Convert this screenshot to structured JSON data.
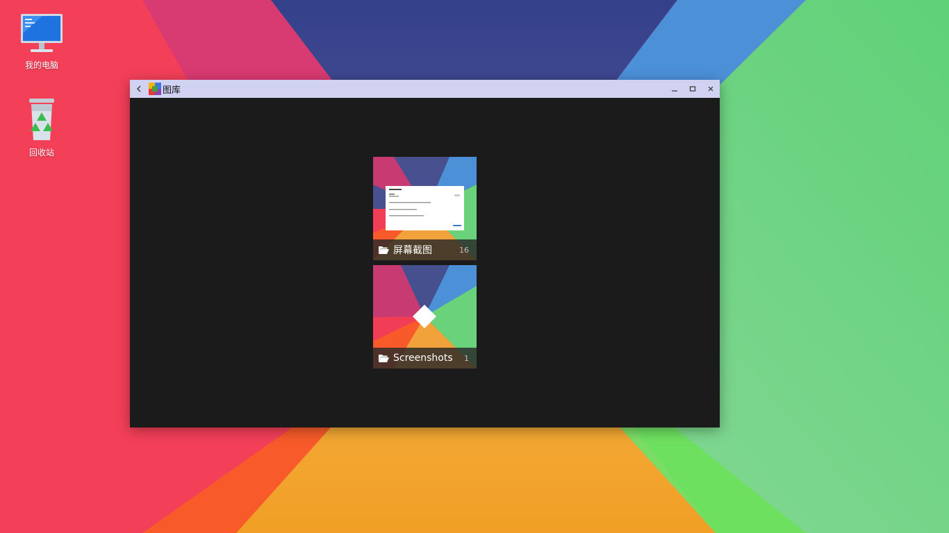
{
  "desktop": {
    "icons": [
      {
        "label": "我的电脑",
        "icon": "computer-icon"
      },
      {
        "label": "回收站",
        "icon": "recycle-bin-icon"
      }
    ]
  },
  "window": {
    "title": "图库",
    "back_icon": "back-arrow-icon",
    "app_icon": "gallery-app-icon",
    "controls": [
      "minimize-icon",
      "maximize-icon",
      "close-icon"
    ]
  },
  "albums": [
    {
      "name": "屏幕截图",
      "count": "16",
      "icon": "folder-open-icon"
    },
    {
      "name": "Screenshots",
      "count": "1",
      "icon": "folder-open-icon"
    }
  ],
  "colors": {
    "titlebar": "#d1d2f2",
    "window_bg": "#1b1b1b",
    "wall_red": "#f23d57",
    "wall_navy": "#3d4a8e",
    "wall_blue": "#4b8fd6",
    "wall_green": "#6ad27a",
    "wall_orange": "#f0a23a"
  }
}
